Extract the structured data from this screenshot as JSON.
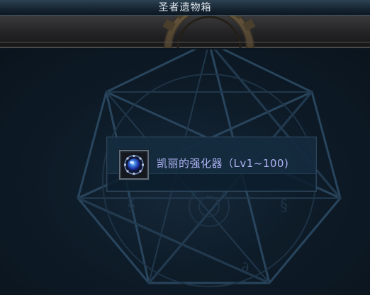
{
  "window": {
    "title": "圣者遗物箱"
  },
  "item": {
    "name": "凯丽的强化器（Lv1~100)",
    "icon": "blue-gem-icon",
    "name_color": "#b0b3f6"
  },
  "colors": {
    "background": "#0b1620",
    "row_border": "#2d4458",
    "emblem_lines": "#2c4a63"
  }
}
